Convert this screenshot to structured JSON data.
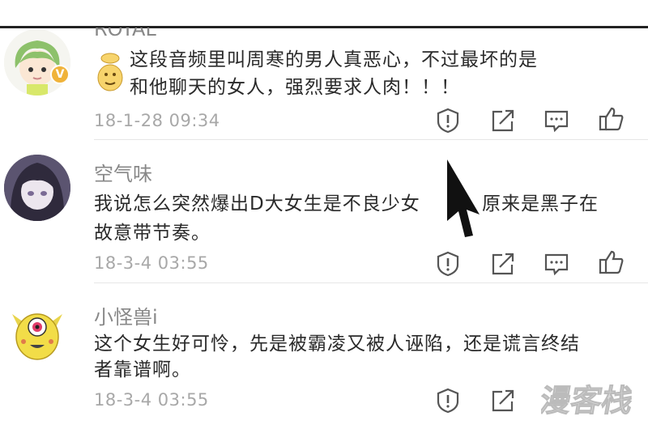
{
  "comments": [
    {
      "username": "ROYAL",
      "badge": "V",
      "text_line1": "这段音频里叫周寒的男人真恶心，不过最坏的是",
      "text_line2": "和他聊天的女人，强烈要求人肉！！！",
      "timestamp": "18-1-28 09:34"
    },
    {
      "username": "空气味",
      "text_line1": "我说怎么突然爆出D大女生是不良少女",
      "text_line1_b": "原来是黑子在",
      "text_line2": "故意带节奏。",
      "timestamp": "18-3-4 03:55"
    },
    {
      "username": "小怪兽i",
      "text_line1": "这个女生好可怜，先是被霸凌又被人诬陷，还是谎言终结",
      "text_line2": "者靠谱啊。",
      "timestamp": "18-3-4 03:55"
    }
  ],
  "actions": [
    "report-icon",
    "share-icon",
    "reply-icon",
    "like-icon"
  ],
  "watermark": "漫客栈",
  "colors": {
    "timestamp": "#a8a8a8",
    "username": "#888888",
    "badge": "#f0b33a",
    "icons": "#555555"
  }
}
